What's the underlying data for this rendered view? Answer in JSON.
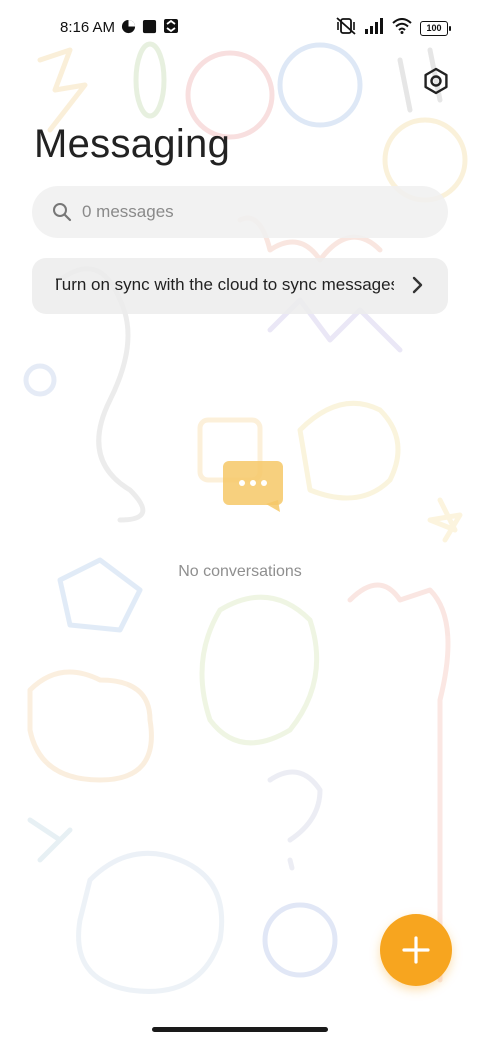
{
  "status_bar": {
    "time": "8:16 AM",
    "battery": "100",
    "icons": [
      "data-saver-icon",
      "square-notification-icon",
      "sync-icon",
      "mute-vibrate-icon",
      "signal-icon",
      "wifi-icon",
      "battery-icon"
    ]
  },
  "header": {
    "title": "Messaging",
    "settings_icon": "hexagon-settings-icon"
  },
  "search": {
    "placeholder": "0 messages",
    "icon": "search-icon"
  },
  "sync_banner": {
    "text": "Turn on sync with the cloud to sync messages",
    "icon": "chevron-right-icon"
  },
  "empty_state": {
    "icon": "chat-bubble-icon",
    "text": "No conversations"
  },
  "fab": {
    "icon": "plus-icon"
  },
  "colors": {
    "accent": "#f7a51f",
    "bubble": "#f6c867"
  }
}
